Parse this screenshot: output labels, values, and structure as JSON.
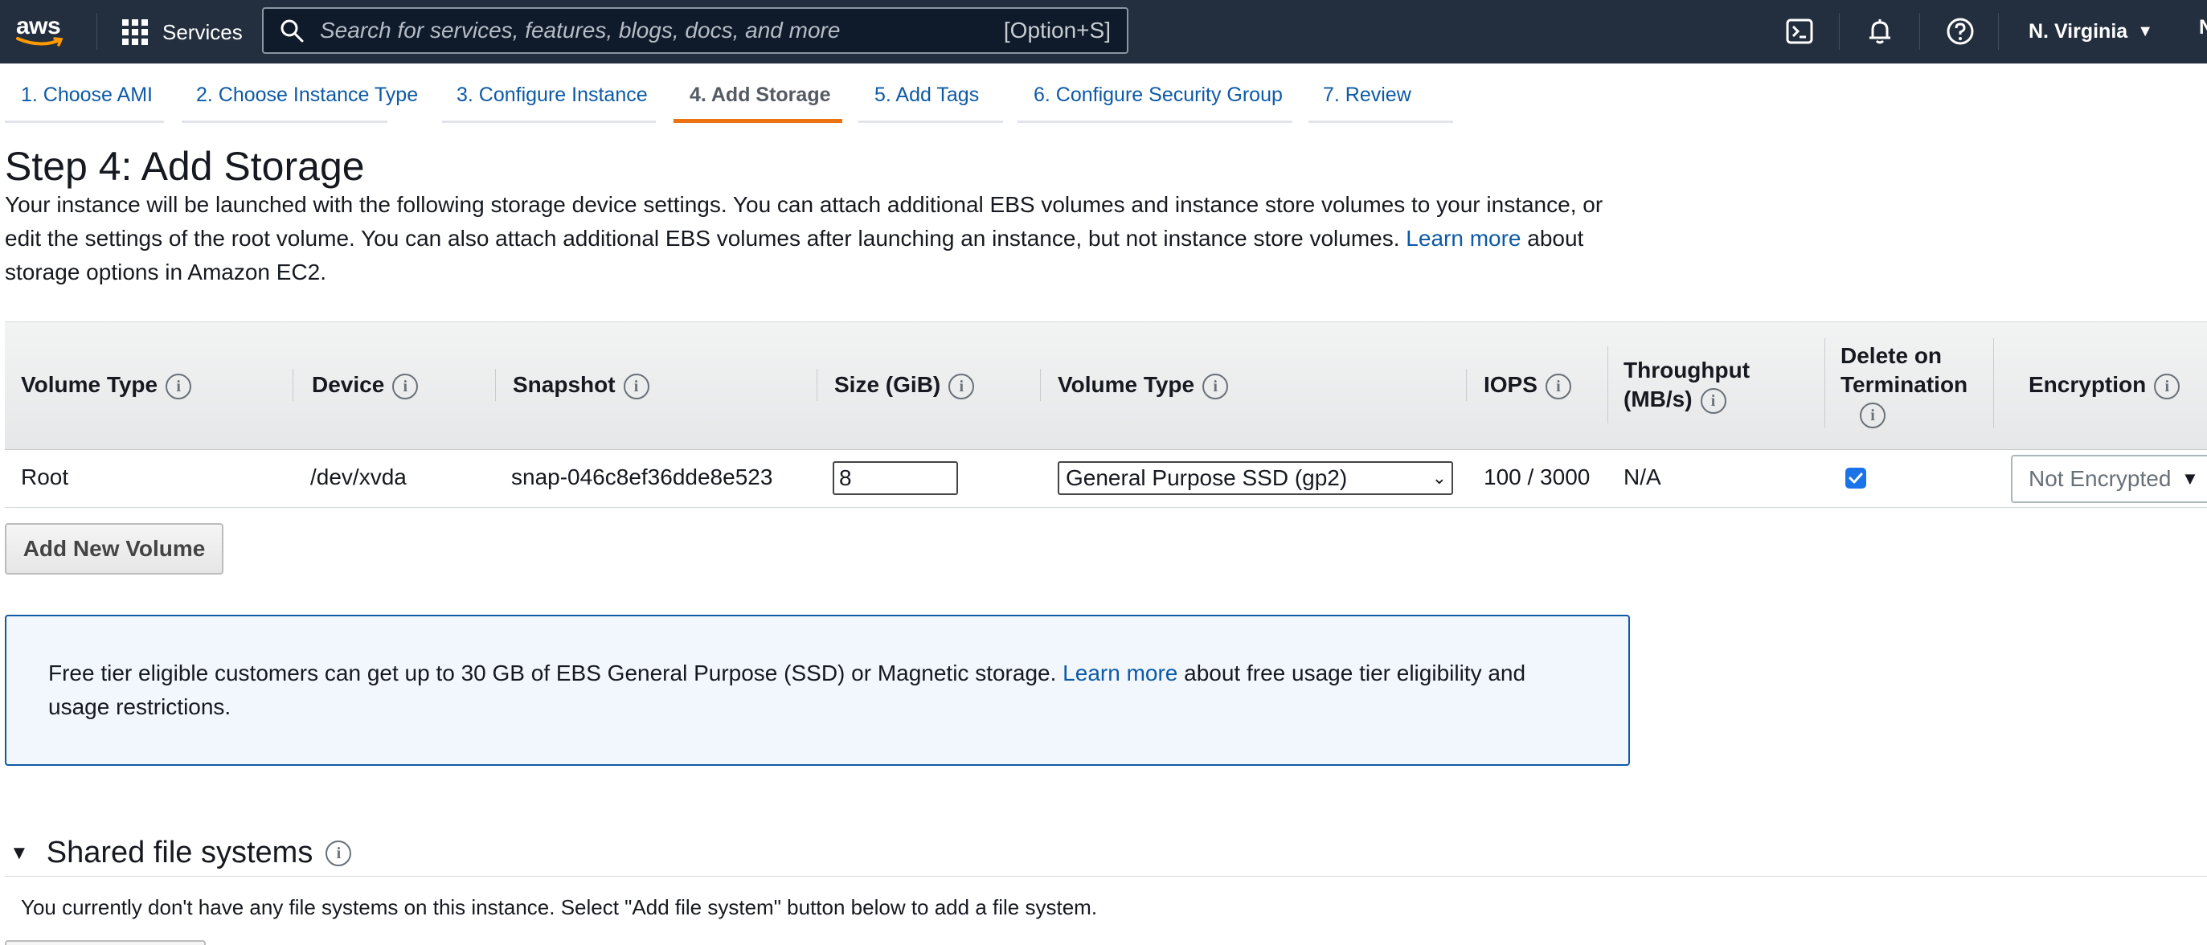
{
  "nav": {
    "logo_text": "aws",
    "services_label": "Services",
    "search_placeholder": "Search for services, features, blogs, docs, and more",
    "search_shortcut": "[Option+S]",
    "icons": [
      "cloudshell-icon",
      "bell-icon",
      "help-icon"
    ],
    "region": "N. Virginia",
    "account_initial": "N"
  },
  "tabs": [
    {
      "label": "1. Choose AMI",
      "active": false
    },
    {
      "label": "2. Choose Instance Type",
      "active": false
    },
    {
      "label": "3. Configure Instance",
      "active": false
    },
    {
      "label": "4. Add Storage",
      "active": true
    },
    {
      "label": "5. Add Tags",
      "active": false
    },
    {
      "label": "6. Configure Security Group",
      "active": false
    },
    {
      "label": "7. Review",
      "active": false
    }
  ],
  "page": {
    "title": "Step 4: Add Storage",
    "desc_1": "Your instance will be launched with the following storage device settings. You can attach additional EBS volumes and instance store volumes to your instance, or edit the settings of the root volume. You can also attach additional EBS volumes after launching an instance, but not instance store volumes.",
    "learn_more": "Learn more",
    "desc_2": "about storage options in Amazon EC2."
  },
  "table": {
    "headers": {
      "volume_type": "Volume Type",
      "device": "Device",
      "snapshot": "Snapshot",
      "size": "Size (GiB)",
      "volume_type_2": "Volume Type",
      "iops": "IOPS",
      "throughput_1": "Throughput",
      "throughput_2": "(MB/s)",
      "delete_1": "Delete on",
      "delete_2": "Termination",
      "encryption": "Encryption"
    },
    "row": {
      "volume_type": "Root",
      "device": "/dev/xvda",
      "snapshot": "snap-046c8ef36dde8e523",
      "size": "8",
      "volume_type_value": "General Purpose SSD (gp2)",
      "iops": "100 / 3000",
      "throughput": "N/A",
      "delete_on_termination": true,
      "encryption": "Not Encrypted"
    }
  },
  "add_volume_label": "Add New Volume",
  "free_tier": {
    "text_1": "Free tier eligible customers can get up to 30 GB of EBS General Purpose (SSD) or Magnetic storage.",
    "learn_more": "Learn more",
    "text_2": "about free usage tier eligibility and usage restrictions."
  },
  "shared_fs": {
    "title": "Shared file systems",
    "text": "You currently don't have any file systems on this instance. Select \"Add file system\" button below to add a file system."
  },
  "colors": {
    "nav_bg": "#232f3e",
    "link": "#0d5aa6",
    "active_tab": "#ec7211",
    "checkbox": "#1a73e8",
    "info_bg": "#f1f7fd"
  }
}
